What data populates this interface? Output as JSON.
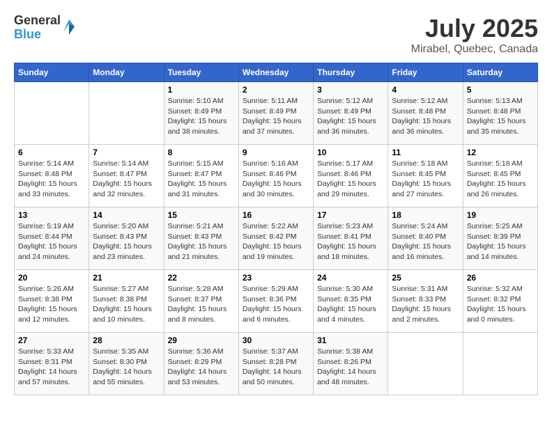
{
  "logo": {
    "line1": "General",
    "line2": "Blue"
  },
  "title": "July 2025",
  "subtitle": "Mirabel, Quebec, Canada",
  "days_of_week": [
    "Sunday",
    "Monday",
    "Tuesday",
    "Wednesday",
    "Thursday",
    "Friday",
    "Saturday"
  ],
  "weeks": [
    [
      {
        "day": "",
        "sunrise": "",
        "sunset": "",
        "daylight": ""
      },
      {
        "day": "",
        "sunrise": "",
        "sunset": "",
        "daylight": ""
      },
      {
        "day": "1",
        "sunrise": "Sunrise: 5:10 AM",
        "sunset": "Sunset: 8:49 PM",
        "daylight": "Daylight: 15 hours and 38 minutes."
      },
      {
        "day": "2",
        "sunrise": "Sunrise: 5:11 AM",
        "sunset": "Sunset: 8:49 PM",
        "daylight": "Daylight: 15 hours and 37 minutes."
      },
      {
        "day": "3",
        "sunrise": "Sunrise: 5:12 AM",
        "sunset": "Sunset: 8:49 PM",
        "daylight": "Daylight: 15 hours and 36 minutes."
      },
      {
        "day": "4",
        "sunrise": "Sunrise: 5:12 AM",
        "sunset": "Sunset: 8:48 PM",
        "daylight": "Daylight: 15 hours and 36 minutes."
      },
      {
        "day": "5",
        "sunrise": "Sunrise: 5:13 AM",
        "sunset": "Sunset: 8:48 PM",
        "daylight": "Daylight: 15 hours and 35 minutes."
      }
    ],
    [
      {
        "day": "6",
        "sunrise": "Sunrise: 5:14 AM",
        "sunset": "Sunset: 8:48 PM",
        "daylight": "Daylight: 15 hours and 33 minutes."
      },
      {
        "day": "7",
        "sunrise": "Sunrise: 5:14 AM",
        "sunset": "Sunset: 8:47 PM",
        "daylight": "Daylight: 15 hours and 32 minutes."
      },
      {
        "day": "8",
        "sunrise": "Sunrise: 5:15 AM",
        "sunset": "Sunset: 8:47 PM",
        "daylight": "Daylight: 15 hours and 31 minutes."
      },
      {
        "day": "9",
        "sunrise": "Sunrise: 5:16 AM",
        "sunset": "Sunset: 8:46 PM",
        "daylight": "Daylight: 15 hours and 30 minutes."
      },
      {
        "day": "10",
        "sunrise": "Sunrise: 5:17 AM",
        "sunset": "Sunset: 8:46 PM",
        "daylight": "Daylight: 15 hours and 29 minutes."
      },
      {
        "day": "11",
        "sunrise": "Sunrise: 5:18 AM",
        "sunset": "Sunset: 8:45 PM",
        "daylight": "Daylight: 15 hours and 27 minutes."
      },
      {
        "day": "12",
        "sunrise": "Sunrise: 5:18 AM",
        "sunset": "Sunset: 8:45 PM",
        "daylight": "Daylight: 15 hours and 26 minutes."
      }
    ],
    [
      {
        "day": "13",
        "sunrise": "Sunrise: 5:19 AM",
        "sunset": "Sunset: 8:44 PM",
        "daylight": "Daylight: 15 hours and 24 minutes."
      },
      {
        "day": "14",
        "sunrise": "Sunrise: 5:20 AM",
        "sunset": "Sunset: 8:43 PM",
        "daylight": "Daylight: 15 hours and 23 minutes."
      },
      {
        "day": "15",
        "sunrise": "Sunrise: 5:21 AM",
        "sunset": "Sunset: 8:43 PM",
        "daylight": "Daylight: 15 hours and 21 minutes."
      },
      {
        "day": "16",
        "sunrise": "Sunrise: 5:22 AM",
        "sunset": "Sunset: 8:42 PM",
        "daylight": "Daylight: 15 hours and 19 minutes."
      },
      {
        "day": "17",
        "sunrise": "Sunrise: 5:23 AM",
        "sunset": "Sunset: 8:41 PM",
        "daylight": "Daylight: 15 hours and 18 minutes."
      },
      {
        "day": "18",
        "sunrise": "Sunrise: 5:24 AM",
        "sunset": "Sunset: 8:40 PM",
        "daylight": "Daylight: 15 hours and 16 minutes."
      },
      {
        "day": "19",
        "sunrise": "Sunrise: 5:25 AM",
        "sunset": "Sunset: 8:39 PM",
        "daylight": "Daylight: 15 hours and 14 minutes."
      }
    ],
    [
      {
        "day": "20",
        "sunrise": "Sunrise: 5:26 AM",
        "sunset": "Sunset: 8:38 PM",
        "daylight": "Daylight: 15 hours and 12 minutes."
      },
      {
        "day": "21",
        "sunrise": "Sunrise: 5:27 AM",
        "sunset": "Sunset: 8:38 PM",
        "daylight": "Daylight: 15 hours and 10 minutes."
      },
      {
        "day": "22",
        "sunrise": "Sunrise: 5:28 AM",
        "sunset": "Sunset: 8:37 PM",
        "daylight": "Daylight: 15 hours and 8 minutes."
      },
      {
        "day": "23",
        "sunrise": "Sunrise: 5:29 AM",
        "sunset": "Sunset: 8:36 PM",
        "daylight": "Daylight: 15 hours and 6 minutes."
      },
      {
        "day": "24",
        "sunrise": "Sunrise: 5:30 AM",
        "sunset": "Sunset: 8:35 PM",
        "daylight": "Daylight: 15 hours and 4 minutes."
      },
      {
        "day": "25",
        "sunrise": "Sunrise: 5:31 AM",
        "sunset": "Sunset: 8:33 PM",
        "daylight": "Daylight: 15 hours and 2 minutes."
      },
      {
        "day": "26",
        "sunrise": "Sunrise: 5:32 AM",
        "sunset": "Sunset: 8:32 PM",
        "daylight": "Daylight: 15 hours and 0 minutes."
      }
    ],
    [
      {
        "day": "27",
        "sunrise": "Sunrise: 5:33 AM",
        "sunset": "Sunset: 8:31 PM",
        "daylight": "Daylight: 14 hours and 57 minutes."
      },
      {
        "day": "28",
        "sunrise": "Sunrise: 5:35 AM",
        "sunset": "Sunset: 8:30 PM",
        "daylight": "Daylight: 14 hours and 55 minutes."
      },
      {
        "day": "29",
        "sunrise": "Sunrise: 5:36 AM",
        "sunset": "Sunset: 8:29 PM",
        "daylight": "Daylight: 14 hours and 53 minutes."
      },
      {
        "day": "30",
        "sunrise": "Sunrise: 5:37 AM",
        "sunset": "Sunset: 8:28 PM",
        "daylight": "Daylight: 14 hours and 50 minutes."
      },
      {
        "day": "31",
        "sunrise": "Sunrise: 5:38 AM",
        "sunset": "Sunset: 8:26 PM",
        "daylight": "Daylight: 14 hours and 48 minutes."
      },
      {
        "day": "",
        "sunrise": "",
        "sunset": "",
        "daylight": ""
      },
      {
        "day": "",
        "sunrise": "",
        "sunset": "",
        "daylight": ""
      }
    ]
  ]
}
